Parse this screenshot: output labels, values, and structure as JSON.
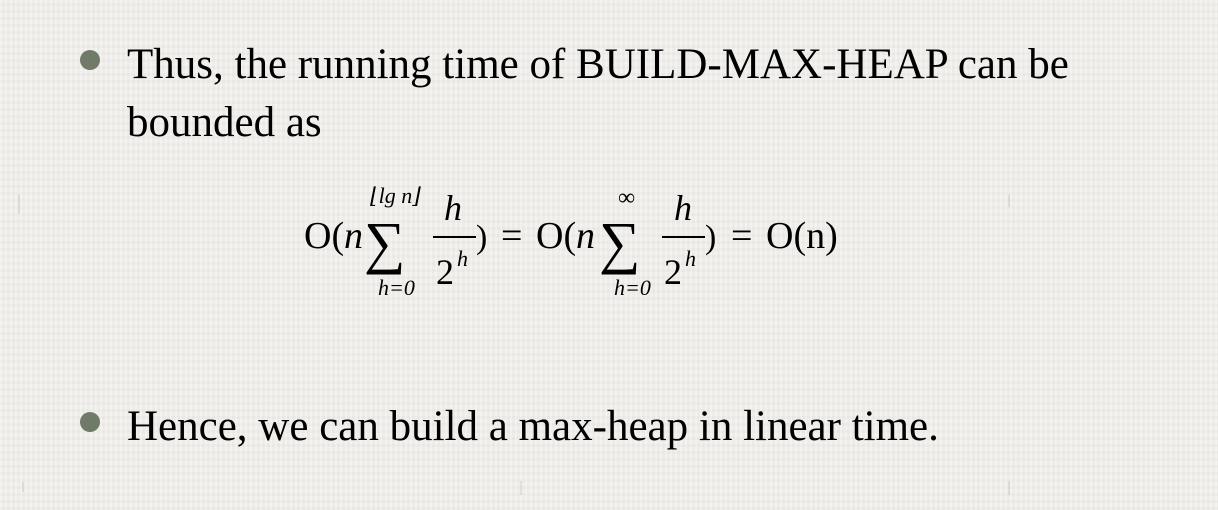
{
  "bullets": [
    {
      "text": "Thus, the running time of BUILD-MAX-HEAP can be bounded as",
      "line_1": "Thus, the running time of BUILD-MAX-HEAP can be",
      "line_2": "bounded as"
    },
    {
      "text": "Hence, we can build a max-heap in linear time."
    }
  ],
  "formula": {
    "o_open_1": "O(",
    "n_1": "n",
    "upper_limit_1": "⌊lg n⌋",
    "sigma": "∑",
    "lower_limit_1": "h=0",
    "numerator": "h",
    "denominator_base": "2",
    "exponent": "h",
    "close_equal_1": ")",
    "equals": "=",
    "o_open_2": "O(",
    "n_2": "n",
    "upper_limit_2": "∞",
    "lower_limit_2": "h=0",
    "close_2": ")",
    "result": "O(n)"
  },
  "colors": {
    "background": "#efeeea",
    "bullet": "#6f7b68",
    "text": "#000000"
  }
}
